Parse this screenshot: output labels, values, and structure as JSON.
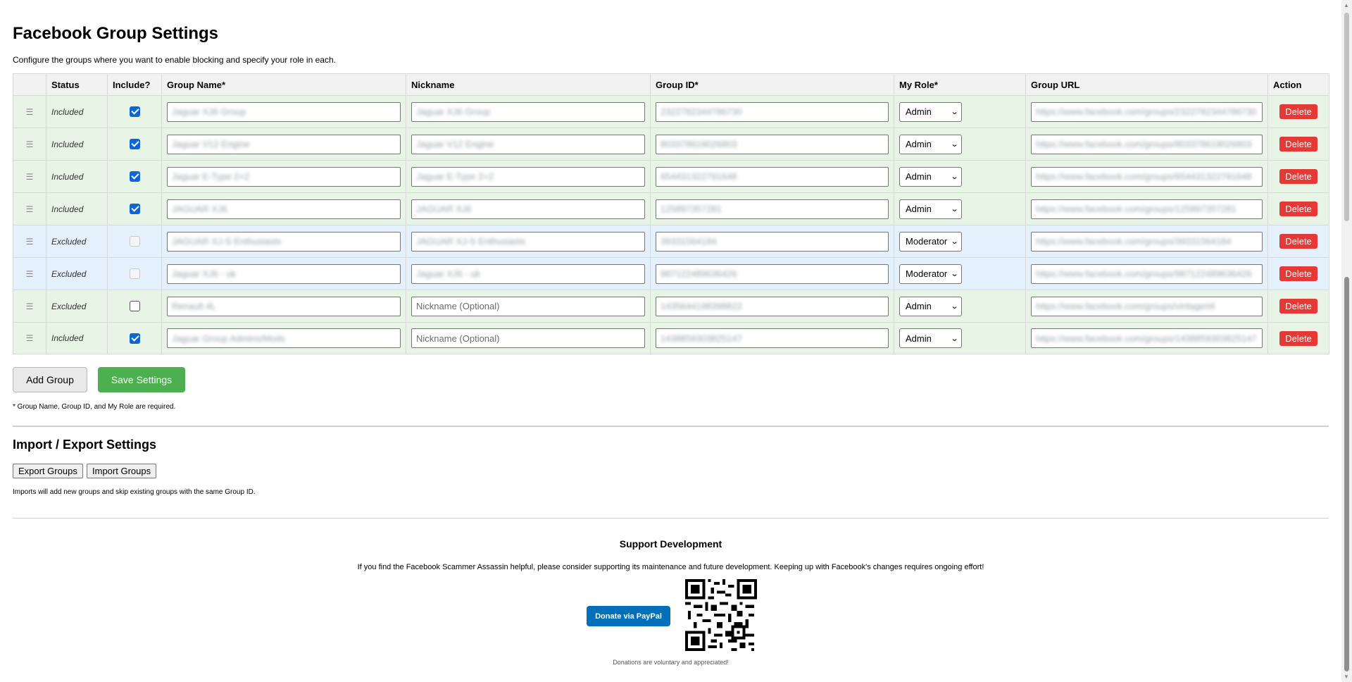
{
  "page": {
    "title": "Facebook Group Settings",
    "subtitle": "Configure the groups where you want to enable blocking and specify your role in each."
  },
  "table": {
    "headers": [
      "",
      "Status",
      "Include?",
      "Group Name*",
      "Nickname",
      "Group ID*",
      "My Role*",
      "Group URL",
      "Action"
    ],
    "rows": [
      {
        "status": "Included",
        "include": true,
        "group_name": "Jaguar XJ6 Group",
        "nickname": "Jaguar XJ6 Group",
        "group_id": "2322782344786730",
        "role": "Admin",
        "url": "https://www.facebook.com/groups/2322782344786730",
        "action": "Delete"
      },
      {
        "status": "Included",
        "include": true,
        "group_name": "Jaguar V12 Engine",
        "nickname": "Jaguar V12 Engine",
        "group_id": "803378619026803",
        "role": "Admin",
        "url": "https://www.facebook.com/groups/803378619026803",
        "action": "Delete"
      },
      {
        "status": "Included",
        "include": true,
        "group_name": "Jaguar E-Type 2+2",
        "nickname": "Jaguar E-Type 2+2",
        "group_id": "654431322791648",
        "role": "Admin",
        "url": "https://www.facebook.com/groups/654431322791648",
        "action": "Delete"
      },
      {
        "status": "Included",
        "include": true,
        "group_name": "JAGUAR XJ6",
        "nickname": "JAGUAR XJ6",
        "group_id": "125897357281",
        "role": "Admin",
        "url": "https://www.facebook.com/groups/125897357281",
        "action": "Delete"
      },
      {
        "status": "Excluded",
        "include": false,
        "disabled": true,
        "group_name": "JAGUAR XJ-S Enthusiasts",
        "nickname": "JAGUAR XJ-S Enthusiasts",
        "group_id": "39331564184",
        "role": "Moderator",
        "url": "https://www.facebook.com/groups/39331564184",
        "action": "Delete"
      },
      {
        "status": "Excluded",
        "include": false,
        "disabled": true,
        "group_name": "Jaguar XJ6 - uk",
        "nickname": "Jaguar XJ6 - uk",
        "group_id": "987122489636426",
        "role": "Moderator",
        "url": "https://www.facebook.com/groups/987122489636426",
        "action": "Delete"
      },
      {
        "status": "Excluded",
        "include": false,
        "disabled": false,
        "group_name": "Renault 4L",
        "nickname": "",
        "nickname_placeholder": "Nickname (Optional)",
        "group_id": "1435644198398822",
        "role": "Admin",
        "url": "https://www.facebook.com/groups/vintagerl4",
        "action": "Delete"
      },
      {
        "status": "Included",
        "include": true,
        "group_name": "Jaguar Group Admins/Mods",
        "nickname": "",
        "nickname_placeholder": "Nickname (Optional)",
        "group_id": "1438859303825147",
        "role": "Admin",
        "url": "https://www.facebook.com/groups/1438859303825147",
        "action": "Delete"
      }
    ]
  },
  "buttons": {
    "add_group": "Add Group",
    "save_settings": "Save Settings"
  },
  "required_note": "* Group Name, Group ID, and My Role are required.",
  "import_export": {
    "title": "Import / Export Settings",
    "export_label": "Export Groups",
    "import_label": "Import Groups",
    "note": "Imports will add new groups and skip existing groups with the same Group ID."
  },
  "support": {
    "title": "Support Development",
    "text": "If you find the Facebook Scammer Assassin helpful, please consider supporting its maintenance and future development. Keeping up with Facebook's changes requires ongoing effort!",
    "paypal_label": "Donate via PayPal",
    "note": "Donations are voluntary and appreciated!"
  },
  "icons": {
    "drag": "drag-handle-icon",
    "dropdown": "chevron-down-icon",
    "qr": "qr-code-icon"
  },
  "colors": {
    "accent_blue": "#0b66d6",
    "save_green": "#4caf50",
    "delete_red": "#e53935",
    "paypal_blue": "#0070ba",
    "included_row": "#e8f5e6",
    "excluded_row": "#e4f0fb"
  }
}
